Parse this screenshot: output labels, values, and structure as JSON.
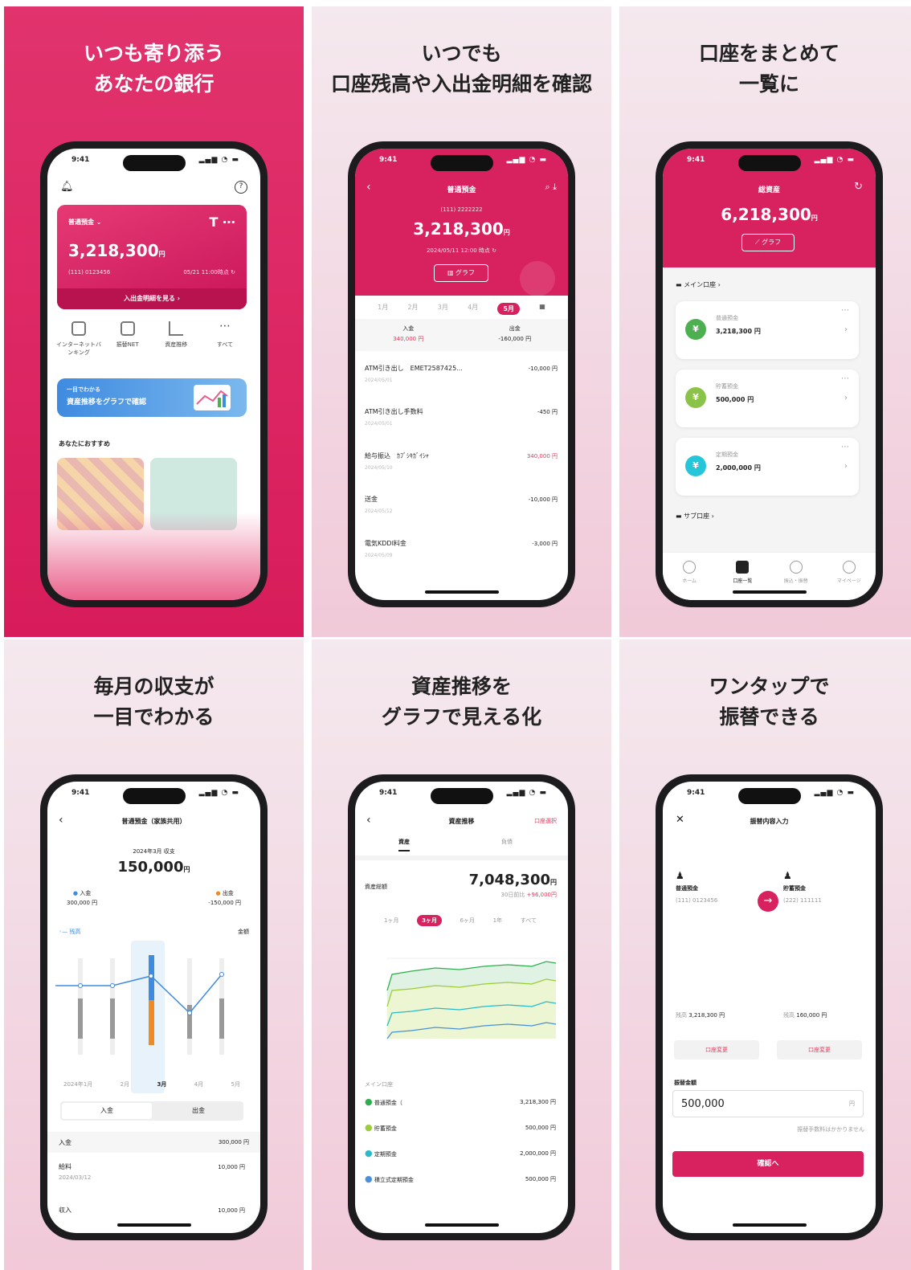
{
  "time": "9:41",
  "panels": [
    {
      "headline": [
        "いつも寄り添う",
        "あなたの銀行"
      ],
      "screen": {
        "card_account": "普通預金",
        "card_balance": "3,218,300",
        "yen": "円",
        "card_account_no": "(111) 0123456",
        "card_timestamp": "05/21 11:00時点",
        "card_link": "入出金明細を見る",
        "menu": [
          "インターネットバンキング",
          "振替NET",
          "資産推移",
          "すべて"
        ],
        "banner_small": "一目でわかる",
        "banner_title": "資産推移をグラフで確認",
        "recommend_title": "あなたにおすすめ"
      }
    },
    {
      "headline": [
        "いつでも",
        "口座残高や入出金明細を確認"
      ],
      "screen": {
        "title": "普通預金",
        "account_no": "(111) 2222222",
        "balance": "3,218,300",
        "yen": "円",
        "timestamp": "2024/05/11 12:00 時点",
        "graph_button": "グラフ",
        "months": [
          "1月",
          "2月",
          "3月",
          "4月",
          "5月"
        ],
        "income_label": "入金",
        "income_value": "340,000 円",
        "expense_label": "出金",
        "expense_value": "-160,000 円",
        "transactions": [
          {
            "desc": "ATM引き出し　EMET2587425...",
            "date": "2024/05/01",
            "amount": "-10,000 円"
          },
          {
            "desc": "ATM引き出し手数料",
            "date": "2024/05/01",
            "amount": "-450 円"
          },
          {
            "desc": "給与振込　ｶﾌﾞｼｷｶﾞｲｼｬ",
            "date": "2024/05/10",
            "amount": "340,000 円"
          },
          {
            "desc": "送金",
            "date": "2024/05/12",
            "amount": "-10,000 円"
          },
          {
            "desc": "電気KDDI料金",
            "date": "2024/05/09",
            "amount": "-3,000 円"
          }
        ]
      }
    },
    {
      "headline": [
        "口座をまとめて",
        "一覧に"
      ],
      "screen": {
        "title": "総資産",
        "balance": "6,218,300",
        "yen": "円",
        "graph_button": "グラフ",
        "main_section": "メイン口座",
        "sub_section": "サブ口座",
        "accounts": [
          {
            "name": "普通預金",
            "amount": "3,218,300 円",
            "color": "#4caf50"
          },
          {
            "name": "貯蓄預金",
            "amount": "500,000 円",
            "color": "#8bc34a"
          },
          {
            "name": "定期預金",
            "amount": "2,000,000 円",
            "color": "#26c6da"
          }
        ],
        "tabs": [
          "ホーム",
          "口座一覧",
          "振込・振替",
          "マイページ"
        ]
      }
    },
    {
      "headline": [
        "毎月の収支が",
        "一目でわかる"
      ],
      "screen": {
        "title": "普通預金（家族共用）",
        "period": "2024年3月 収支",
        "balance": "150,000",
        "yen": "円",
        "income_label": "入金",
        "income_value": "300,000 円",
        "expense_label": "出金",
        "expense_value": "-150,000 円",
        "legend": "残高",
        "right_unit": "金額",
        "months": [
          "2024年1月",
          "2月",
          "3月",
          "4月",
          "5月"
        ],
        "seg": [
          "入金",
          "出金"
        ],
        "rows": [
          {
            "label": "入金",
            "date": "",
            "amount": "300,000 円"
          },
          {
            "label": "給料",
            "date": "2024/03/12",
            "amount": "10,000 円"
          },
          {
            "label": "収入",
            "date": "",
            "amount": "10,000 円"
          }
        ]
      }
    },
    {
      "headline": [
        "資産推移を",
        "グラフで見える化"
      ],
      "screen": {
        "title": "資産推移",
        "right_link": "口座選択",
        "tabs": [
          "資産",
          "負債"
        ],
        "total_label": "資産総額",
        "total": "7,048,300",
        "yen": "円",
        "change_label": "30日前比",
        "change": "+96,000円",
        "ranges": [
          "1ヶ月",
          "3ヶ月",
          "6ヶ月",
          "1年",
          "すべて"
        ],
        "section": "メイン口座",
        "accounts": [
          {
            "name": "普通預金（",
            "amount": "3,218,300 円",
            "color": "#2eae4e"
          },
          {
            "name": "貯蓄預金",
            "amount": "500,000 円",
            "color": "#9ccc3a"
          },
          {
            "name": "定期預金",
            "amount": "2,000,000 円",
            "color": "#2bbac8"
          },
          {
            "name": "積立式定期預金",
            "amount": "500,000 円",
            "color": "#4a90d9"
          }
        ]
      }
    },
    {
      "headline": [
        "ワンタップで",
        "振替できる"
      ],
      "screen": {
        "title": "振替内容入力",
        "from_name": "普通預金",
        "from_no": "(111) 0123456",
        "from_balance_label": "残高",
        "from_balance": "3,218,300 円",
        "to_name": "貯蓄預金",
        "to_no": "(222) 111111",
        "to_balance_label": "残高",
        "to_balance": "160,000 円",
        "change_button": "口座変更",
        "amount_label": "振替金額",
        "amount_value": "500,000",
        "yen": "円",
        "fee_note": "振替手数料はかかりません",
        "confirm": "確認へ"
      }
    }
  ]
}
